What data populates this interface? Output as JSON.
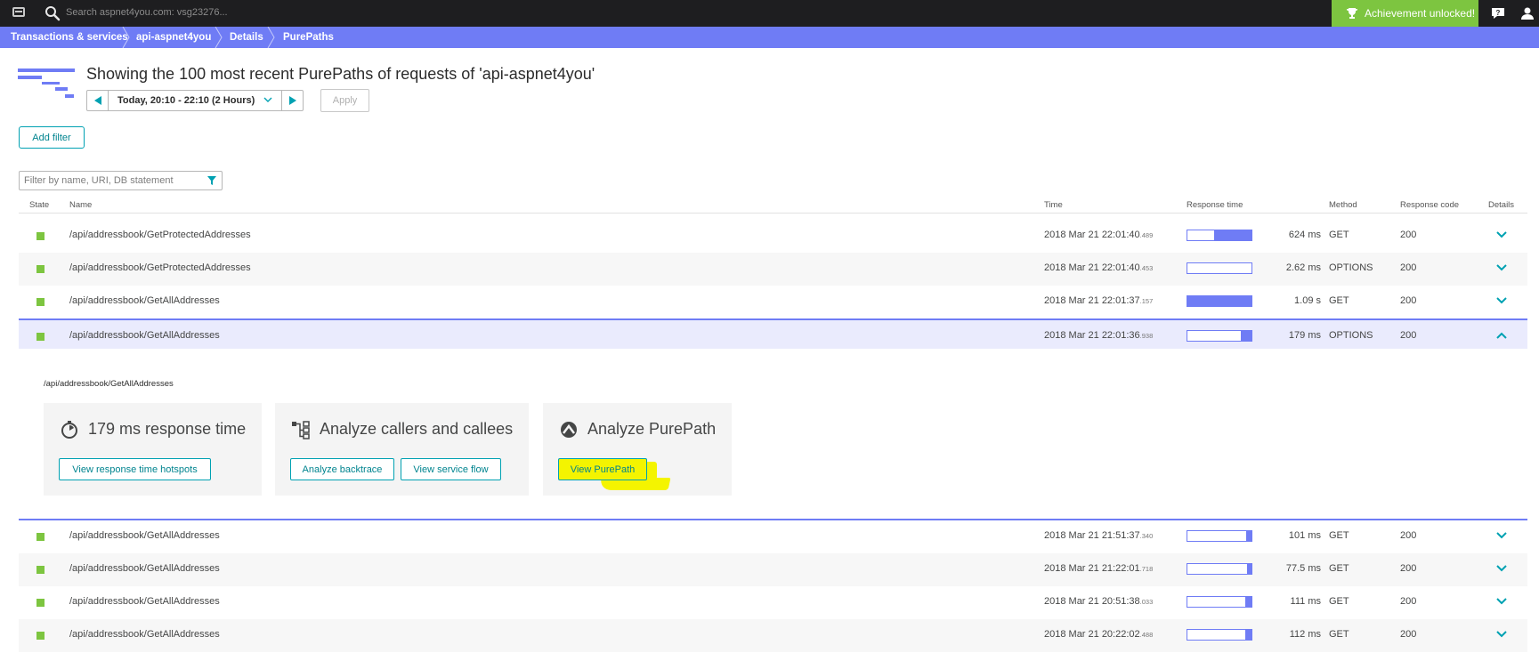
{
  "topbar": {
    "search_placeholder": "Search aspnet4you.com: vsg23276...",
    "achievement_label": "Achievement unlocked!"
  },
  "breadcrumb": [
    "Transactions & services",
    "api-aspnet4you",
    "Details",
    "PurePaths"
  ],
  "header": {
    "title": "Showing the 100 most recent PurePaths of requests of 'api-aspnet4you'",
    "timeframe": "Today, 20:10 - 22:10 (2 Hours)",
    "apply_label": "Apply"
  },
  "filters": {
    "add_filter_label": "Add filter",
    "search_placeholder": "Filter by name, URI, DB statement"
  },
  "table": {
    "columns": {
      "state": "State",
      "name": "Name",
      "time": "Time",
      "response_time": "Response time",
      "method": "Method",
      "response_code": "Response code",
      "details": "Details"
    },
    "rows": [
      {
        "name": "/api/addressbook/GetProtectedAddresses",
        "time": "2018 Mar 21 22:01:40",
        "ms": ".489",
        "response": "624 ms",
        "fill": 0.58,
        "method": "GET",
        "code": "200"
      },
      {
        "name": "/api/addressbook/GetProtectedAddresses",
        "time": "2018 Mar 21 22:01:40",
        "ms": ".453",
        "response": "2.62 ms",
        "fill": 0.0,
        "method": "OPTIONS",
        "code": "200"
      },
      {
        "name": "/api/addressbook/GetAllAddresses",
        "time": "2018 Mar 21 22:01:37",
        "ms": ".157",
        "response": "1.09 s",
        "fill": 1.0,
        "method": "GET",
        "code": "200"
      },
      {
        "name": "/api/addressbook/GetAllAddresses",
        "time": "2018 Mar 21 22:01:36",
        "ms": ".938",
        "response": "179 ms",
        "fill": 0.16,
        "method": "OPTIONS",
        "code": "200"
      },
      {
        "name": "/api/addressbook/GetAllAddresses",
        "time": "2018 Mar 21 21:51:37",
        "ms": ".340",
        "response": "101 ms",
        "fill": 0.09,
        "method": "GET",
        "code": "200"
      },
      {
        "name": "/api/addressbook/GetAllAddresses",
        "time": "2018 Mar 21 21:22:01",
        "ms": ".718",
        "response": "77.5 ms",
        "fill": 0.07,
        "method": "GET",
        "code": "200"
      },
      {
        "name": "/api/addressbook/GetAllAddresses",
        "time": "2018 Mar 21 20:51:38",
        "ms": ".033",
        "response": "111 ms",
        "fill": 0.1,
        "method": "GET",
        "code": "200"
      },
      {
        "name": "/api/addressbook/GetAllAddresses",
        "time": "2018 Mar 21 20:22:02",
        "ms": ".488",
        "response": "112 ms",
        "fill": 0.1,
        "method": "GET",
        "code": "200"
      }
    ]
  },
  "detail": {
    "path": "/api/addressbook/GetAllAddresses",
    "cards": [
      {
        "title": "179 ms response time",
        "buttons": [
          "View response time hotspots"
        ]
      },
      {
        "title": "Analyze callers and callees",
        "buttons": [
          "Analyze backtrace",
          "View service flow"
        ]
      },
      {
        "title": "Analyze PurePath",
        "buttons": [
          "View PurePath"
        ]
      }
    ]
  },
  "colors": {
    "accent": "#6f7cf5",
    "teal": "#00a1b2",
    "success": "#7dc540",
    "highlight": "#f4f400"
  }
}
